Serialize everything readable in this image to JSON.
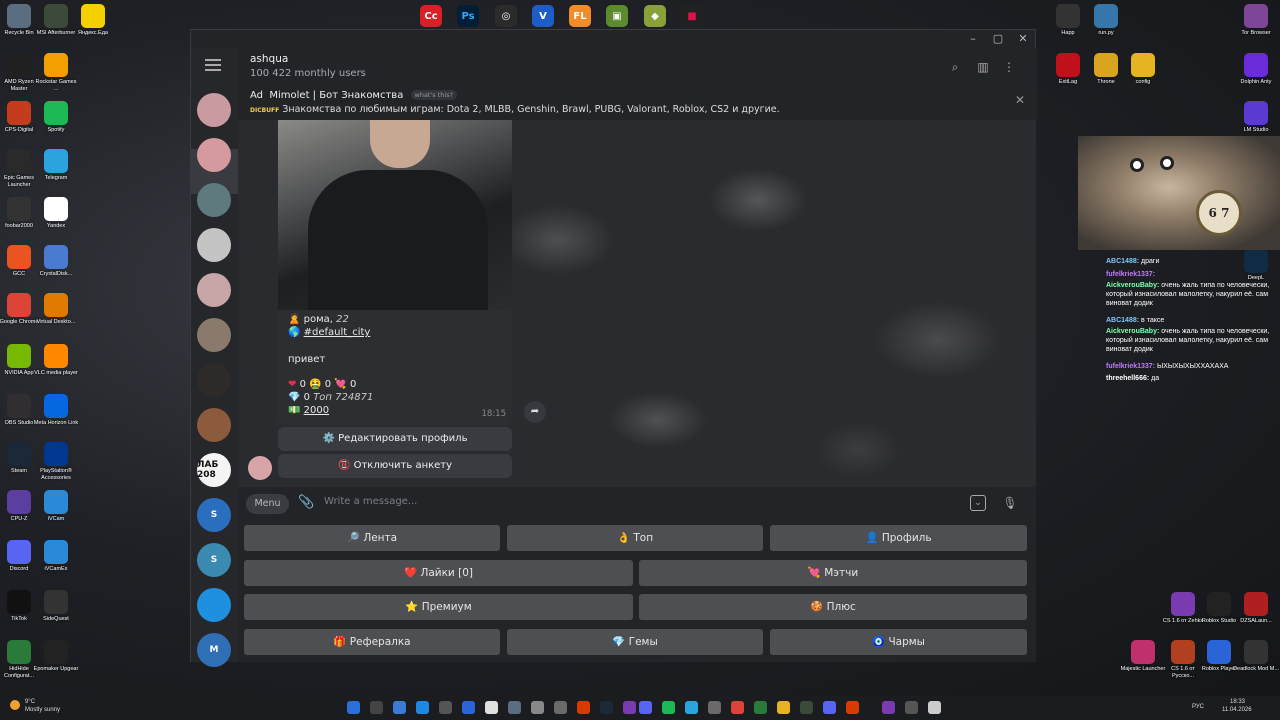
{
  "desktop_icons_left": [
    {
      "label": "Recycle Bin",
      "color": "#5b6d80"
    },
    {
      "label": "MSI Afterburner",
      "color": "#3c4a3a"
    },
    {
      "label": "Яндекс.Еда",
      "color": "#f5d000"
    },
    {
      "label": "AMD Ryzen Master",
      "color": "#202020"
    },
    {
      "label": "Rockstar Games ...",
      "color": "#f0a000"
    },
    {
      "label": "CPS-Digital",
      "color": "#c53c1c"
    },
    {
      "label": "Spotify",
      "color": "#1db954"
    },
    {
      "label": "Epic Games Launcher",
      "color": "#2a2a2a"
    },
    {
      "label": "Telegram",
      "color": "#2aa3de"
    },
    {
      "label": "foobar2000",
      "color": "#333"
    },
    {
      "label": "Yandex",
      "color": "#ffffff"
    },
    {
      "label": "GCC",
      "color": "#e95420"
    },
    {
      "label": "CrystalDisk...",
      "color": "#4a7bd0"
    },
    {
      "label": "Google Chrome",
      "color": "#db4437"
    },
    {
      "label": "Virtual Deskto...",
      "color": "#e07b00"
    },
    {
      "label": "NVIDIA App",
      "color": "#76b900"
    },
    {
      "label": "VLC media player",
      "color": "#ff8800"
    },
    {
      "label": "OBS Studio",
      "color": "#302e31"
    },
    {
      "label": "Meta Horizon Link",
      "color": "#0668e1"
    },
    {
      "label": "Steam",
      "color": "#1b2838"
    },
    {
      "label": "PlayStation® Accessories",
      "color": "#003791"
    },
    {
      "label": "CPU-Z",
      "color": "#5b3fa0"
    },
    {
      "label": "iVCam",
      "color": "#2b8ad8"
    },
    {
      "label": "Discord",
      "color": "#5865f2"
    },
    {
      "label": "iVCamEx",
      "color": "#2b8ad8"
    },
    {
      "label": "TikTok",
      "color": "#111"
    },
    {
      "label": "SideQuest",
      "color": "#333"
    },
    {
      "label": "HidHide Configurat...",
      "color": "#2a7a3a"
    },
    {
      "label": "Epomaker Upgear",
      "color": "#222"
    }
  ],
  "desktop_icons_right": [
    {
      "label": "Tor Browser",
      "color": "#7d4698"
    },
    {
      "label": "Happ",
      "color": "#333"
    },
    {
      "label": "run.py",
      "color": "#3776ab"
    },
    {
      "label": "ExitLag",
      "color": "#c0101a"
    },
    {
      "label": "Throne",
      "color": "#d9a520"
    },
    {
      "label": "config",
      "color": "#e6b422"
    },
    {
      "label": "Dolphin Anty",
      "color": "#6a2bd8"
    },
    {
      "label": "LM Studio",
      "color": "#5a3ad0"
    },
    {
      "label": "DeepL",
      "color": "#0f2b46"
    },
    {
      "label": "CS 1.6 от Zehks",
      "color": "#7a3bb0"
    },
    {
      "label": "Roblox Studio",
      "color": "#222"
    },
    {
      "label": "DZSALaun...",
      "color": "#b02020"
    },
    {
      "label": "Majestic Launcher",
      "color": "#c0306a"
    },
    {
      "label": "CS 1.6 от Русско...",
      "color": "#b04020"
    },
    {
      "label": "Roblox Player",
      "color": "#2b63d8"
    },
    {
      "label": "Deadlock Mod M...",
      "color": "#333"
    }
  ],
  "window": {
    "chat_title": "ashqua",
    "chat_subtitle": "100 422 monthly users",
    "ad_label": "Ad",
    "ad_title": "Mimolet | Бот Знакомства",
    "ad_whats": "what's this?",
    "ad_text": "Знакомства по любимым играм: Dota 2, MLBB, Genshin, Brawl, PUBG, Valorant, Roblox, CS2 и другие.",
    "ad_badge": "DICBUFF"
  },
  "chat_list_avatars": [
    {
      "color": "#c99ba1",
      "text": ""
    },
    {
      "color": "#d49aa0",
      "text": ""
    },
    {
      "color": "#5f7a7e",
      "text": ""
    },
    {
      "color": "#c4c4c4",
      "text": ""
    },
    {
      "color": "#c8a6a8",
      "text": ""
    },
    {
      "color": "#8a7a6c",
      "text": ""
    },
    {
      "color": "#2f2a2a",
      "text": ""
    },
    {
      "color": "#8c5a3c",
      "text": ""
    },
    {
      "color": "#f4f4f4",
      "text": "ЛАБ 208"
    },
    {
      "color": "#2a6fbf",
      "text": "S"
    },
    {
      "color": "#3b8ab2",
      "text": "S"
    },
    {
      "color": "#1f8fe0",
      "text": ""
    },
    {
      "color": "#2f6fb5",
      "text": "M"
    }
  ],
  "message": {
    "name_line": "рома,",
    "age": "22",
    "city_tag": "#default_city",
    "greeting": "привет",
    "likes_line": "0",
    "likes_a": "0",
    "likes_b": "0",
    "gems_line": "0",
    "top_text": "Топ 724871",
    "coins_line": "2000",
    "time": "18:15"
  },
  "inline_buttons": {
    "edit_profile": "Редактировать профиль",
    "disable_profile": "Отключить анкету"
  },
  "input": {
    "menu_label": "Menu",
    "placeholder": "Write a message..."
  },
  "keyboard": {
    "feed": "Лента",
    "top": "Топ",
    "profile": "Профиль",
    "likes": "Лайки [0]",
    "matches": "Мэтчи",
    "premium": "Премиум",
    "plus": "Плюс",
    "referral": "Рефералка",
    "gems": "Гемы",
    "charms": "Чармы"
  },
  "stream_chat": [
    {
      "user": "ABC1488:",
      "text": "драги",
      "color": "#7ec8ff"
    },
    {
      "user": "fufelkriek1337:",
      "text": "",
      "color": "#c07bff"
    },
    {
      "user": "AickverouBaby:",
      "text": "очень жаль типа по человечески, который изнасиловал малолетку, накурил её. сам виноват додик",
      "color": "#7dffb0"
    },
    {
      "user": "ABC1488:",
      "text": "в таксе",
      "color": "#7ec8ff"
    },
    {
      "user": "AickverouBaby:",
      "text": "очень жаль типа по человечески, который изнасиловал малолетку, накурил её. сам виноват додик",
      "color": "#7dffb0"
    },
    {
      "user": "fufelkriek1337:",
      "text": "ЫХЫХЫХЫХХАХАХА",
      "color": "#c07bff"
    },
    {
      "user": "threehell666:",
      "text": "да",
      "color": "#ffffff"
    }
  ],
  "taskbar": {
    "weather_temp": "9°C",
    "weather_desc": "Mostly sunny",
    "lang": "РУС",
    "time": "18:33",
    "date": "11.04.2026"
  }
}
